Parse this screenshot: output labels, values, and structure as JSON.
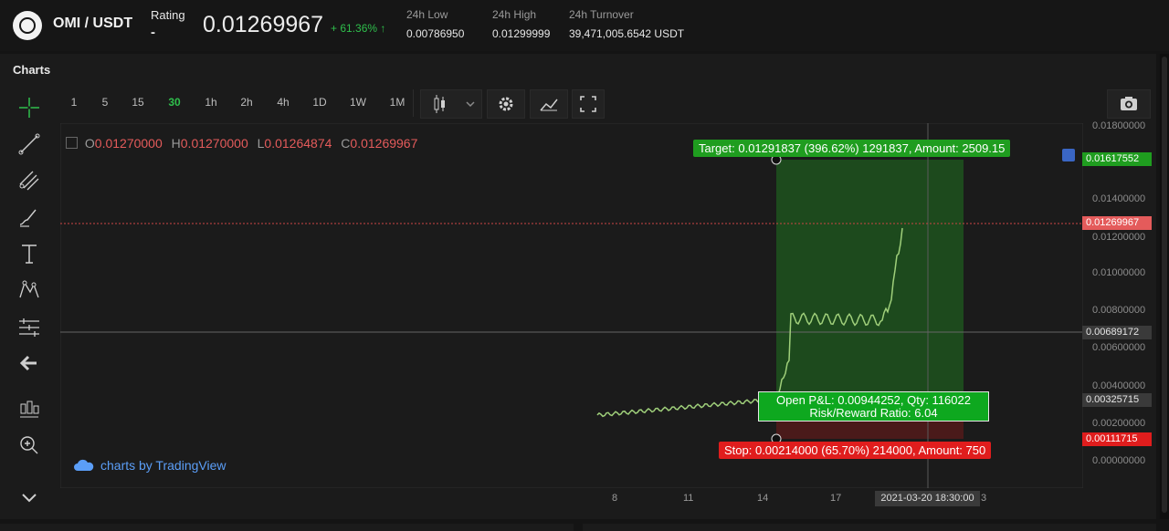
{
  "header": {
    "pair": "OMI / USDT",
    "rating_label": "Rating",
    "rating_value": "-",
    "price": "0.01269967",
    "change": "+ 61.36% ↑",
    "low_label": "24h Low",
    "low_value": "0.00786950",
    "high_label": "24h High",
    "high_value": "0.01299999",
    "turnover_label": "24h Turnover",
    "turnover_value": "39,471,005.6542 USDT"
  },
  "panel": {
    "title": "Charts"
  },
  "timeframes": [
    {
      "label": "1"
    },
    {
      "label": "5"
    },
    {
      "label": "15"
    },
    {
      "label": "30",
      "active": true
    },
    {
      "label": "1h"
    },
    {
      "label": "2h"
    },
    {
      "label": "4h"
    },
    {
      "label": "1D"
    },
    {
      "label": "1W"
    },
    {
      "label": "1M"
    }
  ],
  "toolbar_icons": [
    "candles-icon",
    "chevron-down-icon",
    "gear-icon",
    "indicators-icon",
    "fullscreen-icon",
    "camera-icon"
  ],
  "left_tools": [
    "crosshair-icon",
    "trend-line-icon",
    "fib-icon",
    "brush-icon",
    "text-icon",
    "pattern-icon",
    "measure-icon",
    "back-arrow-icon",
    "candle-stack-icon",
    "zoom-in-icon",
    "chevron-down-icon"
  ],
  "ohlc": {
    "o_label": "O",
    "o_value": "0.01270000",
    "h_label": "H",
    "h_value": "0.01270000",
    "l_label": "L",
    "l_value": "0.01264874",
    "c_label": "C",
    "c_value": "0.01269967"
  },
  "y_axis": [
    "0.01800000",
    "0.01400000",
    "0.01200000",
    "0.01000000",
    "0.00800000",
    "0.00600000",
    "0.00400000",
    "0.00200000",
    "0.00000000"
  ],
  "price_tags": {
    "target": "0.01617552",
    "current": "0.01269967",
    "crosshair": "0.00689172",
    "entry": "0.00325715",
    "stop": "0.00111715"
  },
  "x_axis": [
    "8",
    "11",
    "14",
    "17",
    "3"
  ],
  "x_cursor": "2021-03-20 18:30:00",
  "position": {
    "target_label": "Target: 0.01291837 (396.62%) 1291837, Amount: 2509.15",
    "pnl_line1": "Open P&L: 0.00944252, Qty: 116022",
    "pnl_line2": "Risk/Reward Ratio: 6.04",
    "stop_label": "Stop: 0.00214000 (65.70%) 214000, Amount: 750"
  },
  "branding": "charts by TradingView",
  "colors": {
    "up": "#2fbf4c",
    "down": "#e45b5b",
    "target_zone": "#1d4a1d",
    "stop_zone": "#4a1a1a",
    "accent_blue": "#4a7fd6"
  }
}
